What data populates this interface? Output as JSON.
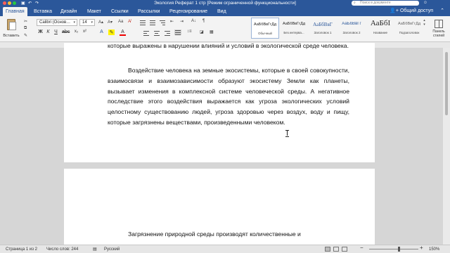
{
  "window": {
    "title": "Экология Реферат 1 стр [Режим ограниченной функциональности]",
    "search_placeholder": "Поиск в документе"
  },
  "tabs": [
    {
      "label": "Главная",
      "active": true
    },
    {
      "label": "Вставка"
    },
    {
      "label": "Дизайн"
    },
    {
      "label": "Макет"
    },
    {
      "label": "Ссылки"
    },
    {
      "label": "Рассылки"
    },
    {
      "label": "Рецензирование"
    },
    {
      "label": "Вид"
    }
  ],
  "share_label": "Общий доступ",
  "ribbon": {
    "paste_label": "Вставить",
    "font_name": "Calibri (Основ…",
    "font_size": "14",
    "bold": "Ж",
    "italic": "К",
    "underline": "Ч",
    "styles": [
      {
        "sample": "АаБбВвГгДд",
        "name": "Обычный",
        "selected": true
      },
      {
        "sample": "АаБбВвГгДд",
        "name": "Без интерва..."
      },
      {
        "sample": "АаБбВвГ",
        "name": "Заголовок 1"
      },
      {
        "sample": "АаБбВвГг",
        "name": "Заголовок 2"
      },
      {
        "sample": "АаБбI",
        "name": "Название"
      },
      {
        "sample": "АаБбВвГгДд",
        "name": "Подзаголовок"
      }
    ],
    "styles_pane_label_1": "Панель",
    "styles_pane_label_2": "стилей"
  },
  "document": {
    "paragraph_1": "которые выражены в нарушении влияний и условий в экологической среде человека.",
    "paragraph_2": "Воздействие человека на земные экосистемы, которые в своей совокупности, взаимосвязи и взаимозависимости образуют экосистему Земли как планеты, вызывает изменения в комплексной системе человеческой среды. А негативное последствие этого воздействия выражается как угроза экологических условий целостному существованию людей, угроза здоровью через воздух, воду и пищу, которые загрязнены веществами, произведенными человеком.",
    "paragraph_3": "Загрязнение природной среды производят количественные и"
  },
  "status": {
    "page": "Страница 1 из 2",
    "words": "Число слов: 244",
    "language": "Русский",
    "zoom": "150%"
  }
}
